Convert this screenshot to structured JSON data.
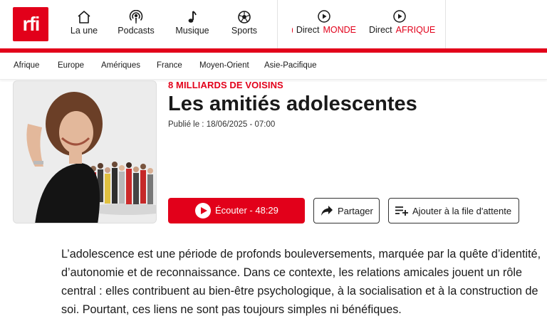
{
  "header": {
    "logo_text": "rfi",
    "nav": [
      {
        "label": "La une",
        "icon": "home-icon"
      },
      {
        "label": "Podcasts",
        "icon": "podcast-icon"
      },
      {
        "label": "Musique",
        "icon": "music-note-icon"
      },
      {
        "label": "Sports",
        "icon": "soccer-ball-icon"
      }
    ],
    "direct": [
      {
        "prefix": "Direct",
        "target": "MONDE"
      },
      {
        "prefix": "Direct",
        "target": "AFRIQUE"
      }
    ]
  },
  "regions": [
    "Afrique",
    "Europe",
    "Amériques",
    "France",
    "Moyen-Orient",
    "Asie-Pacifique"
  ],
  "article": {
    "kicker": "8 MILLIARDS DE VOISINS",
    "title": "Les amitiés adolescentes",
    "published": "Publié le : 18/06/2025 - 07:00",
    "listen_label": "Écouter - 48:29",
    "share_label": "Partager",
    "queue_label": "Ajouter à la file d'attente",
    "intro": "L’adolescence est une période de profonds bouleversements, marquée par la quête d’identité, d’autonomie et de reconnaissance. Dans ce contexte, les relations amicales jouent un rôle central : elles contribuent au bien-être psychologique, à la socialisation et à la construction de soi. Pourtant, ces liens ne sont pas toujours simples ni bénéfiques."
  },
  "colors": {
    "brand_red": "#e2001a",
    "text": "#1a1a1a",
    "border": "#333333"
  }
}
